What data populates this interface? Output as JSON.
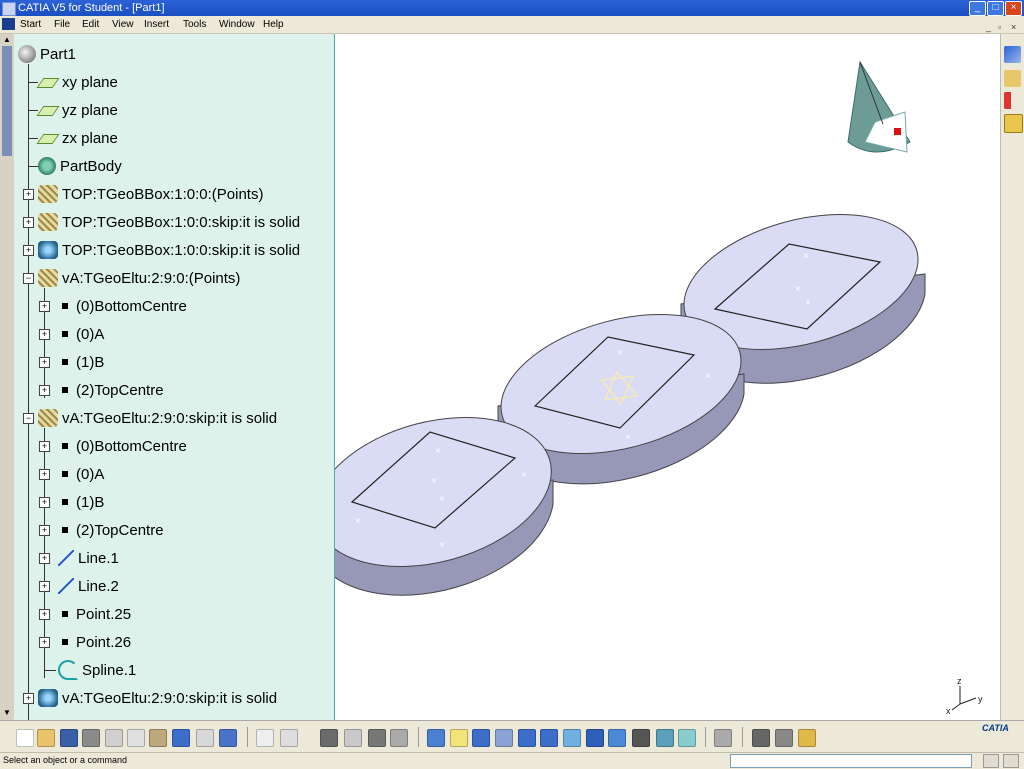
{
  "window": {
    "title": "CATIA V5 for Student - [Part1]"
  },
  "menu": {
    "items": [
      {
        "label": "Start"
      },
      {
        "label": "File"
      },
      {
        "label": "Edit"
      },
      {
        "label": "View"
      },
      {
        "label": "Insert"
      },
      {
        "label": "Tools"
      },
      {
        "label": "Window"
      },
      {
        "label": "Help"
      }
    ]
  },
  "tree": {
    "root": "Part1",
    "nodes": [
      {
        "label": "xy plane",
        "icon": "plane-icon"
      },
      {
        "label": "yz plane",
        "icon": "plane-icon"
      },
      {
        "label": "zx plane",
        "icon": "plane-icon"
      },
      {
        "label": "PartBody",
        "icon": "body-icon"
      },
      {
        "label": "TOP:TGeoBBox:1:0:0:(Points)",
        "icon": "box-icon"
      },
      {
        "label": "TOP:TGeoBBox:1:0:0:skip:it is solid",
        "icon": "box-icon"
      },
      {
        "label": "TOP:TGeoBBox:1:0:0:skip:it is solid",
        "icon": "box-solid-icon"
      },
      {
        "label": "vA:TGeoEltu:2:9:0:(Points)",
        "icon": "box-icon"
      },
      {
        "label": "(0)BottomCentre",
        "icon": "point-icon"
      },
      {
        "label": "(0)A",
        "icon": "point-icon"
      },
      {
        "label": "(1)B",
        "icon": "point-icon"
      },
      {
        "label": "(2)TopCentre",
        "icon": "point-icon"
      },
      {
        "label": "vA:TGeoEltu:2:9:0:skip:it is solid",
        "icon": "box-icon"
      },
      {
        "label": "(0)BottomCentre",
        "icon": "point-icon"
      },
      {
        "label": "(0)A",
        "icon": "point-icon"
      },
      {
        "label": "(1)B",
        "icon": "point-icon"
      },
      {
        "label": "(2)TopCentre",
        "icon": "point-icon"
      },
      {
        "label": "Line.1",
        "icon": "line-icon"
      },
      {
        "label": "Line.2",
        "icon": "line-icon"
      },
      {
        "label": "Point.25",
        "icon": "point-icon"
      },
      {
        "label": "Point.26",
        "icon": "point-icon"
      },
      {
        "label": "Spline.1",
        "icon": "spline-icon"
      },
      {
        "label": "vA:TGeoEltu:2:9:0:skip:it is solid",
        "icon": "box-solid-icon"
      }
    ]
  },
  "axis": {
    "z": "z",
    "y": "y",
    "x": "x"
  },
  "status": {
    "message": "Select an object or a command"
  },
  "logo": {
    "text": "CATIA"
  },
  "colors": {
    "titlebar": "#1a4fc2",
    "tree_bg": "#dcf2ea",
    "disc_top": "#dadbf4",
    "disc_side": "#9797b8"
  }
}
